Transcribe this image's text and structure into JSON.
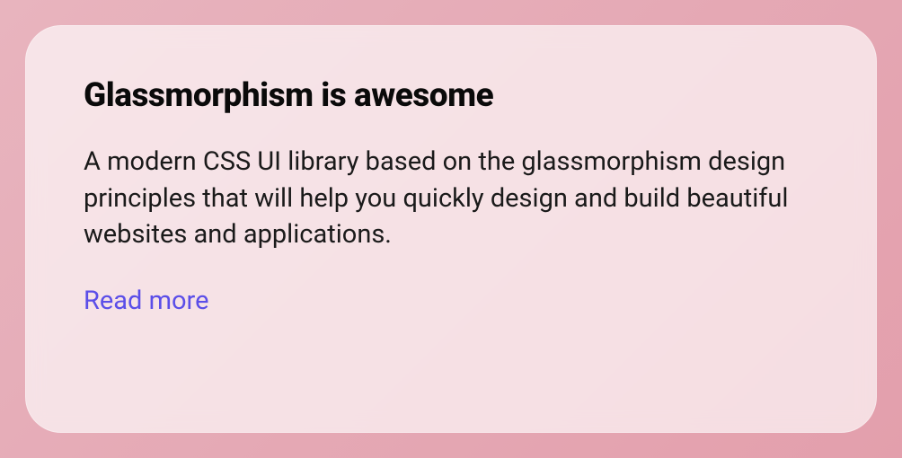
{
  "card": {
    "title": "Glassmorphism is awesome",
    "description": "A modern CSS UI library based on the glassmorphism design principles that will help you quickly design and build beautiful websites and applications.",
    "link_label": "Read more"
  }
}
